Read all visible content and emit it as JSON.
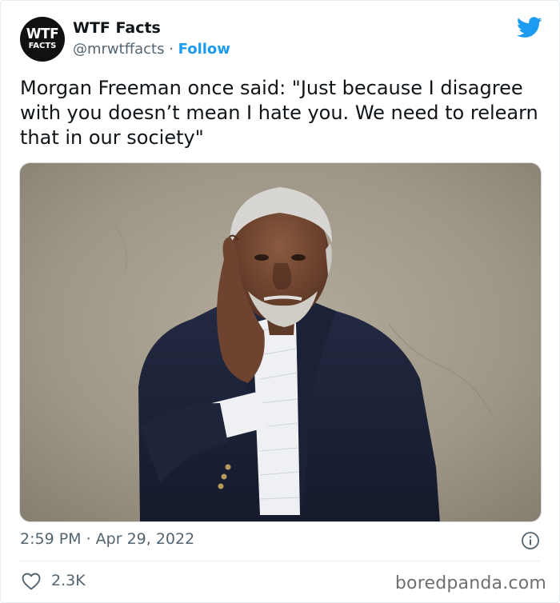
{
  "author": {
    "avatar_line1": "WTF",
    "avatar_line2": "FACTS",
    "name": "WTF Facts",
    "handle": "@mrwtffacts",
    "separator": " · ",
    "follow_label": "Follow"
  },
  "tweet": {
    "text": "Morgan Freeman once said: \"Just because I disagree with you doesn’t mean I hate you. We need to relearn that in our society\"",
    "timestamp": "2:59 PM · Apr 29, 2022",
    "like_count": "2.3K"
  },
  "icons": {
    "platform": "twitter-bird-icon",
    "info": "info-icon",
    "like": "heart-icon"
  },
  "watermark": "boredpanda.com",
  "colors": {
    "link": "#1d9bf0",
    "secondary_text": "#536471",
    "primary_text": "#0f1419"
  }
}
